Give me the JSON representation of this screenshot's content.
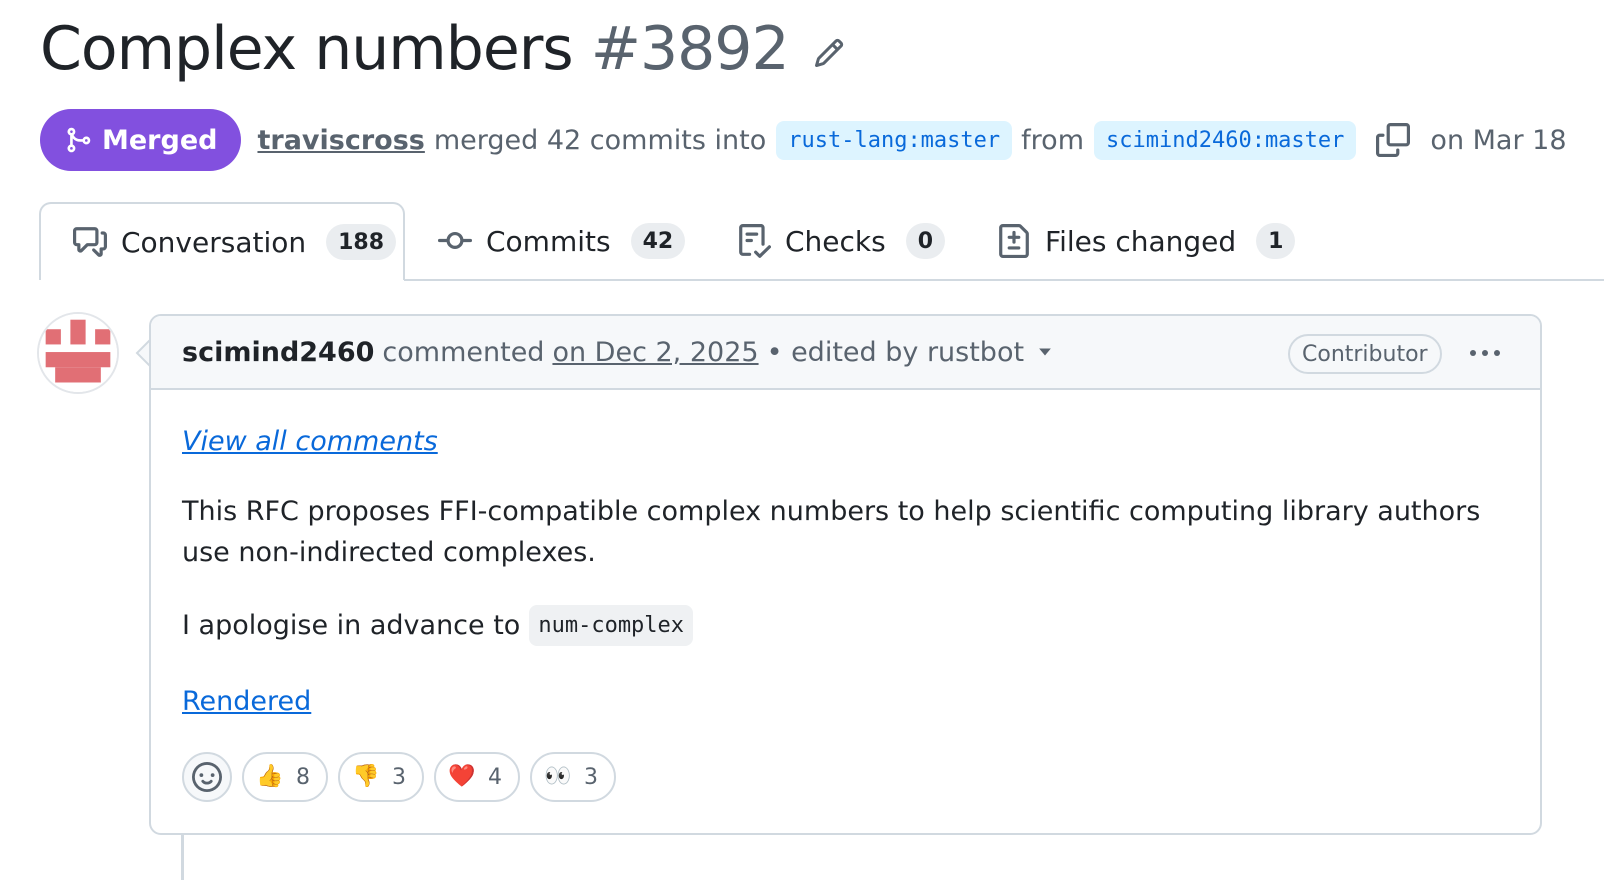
{
  "title": {
    "text": "Complex numbers",
    "number": "#3892"
  },
  "meta": {
    "state": "Merged",
    "author": "traviscross",
    "action": "merged 42 commits into",
    "base_branch": "rust-lang:master",
    "from_word": "from",
    "head_branch": "scimind2460:master",
    "date": "on Mar 18"
  },
  "tabs": [
    {
      "label": "Conversation",
      "count": "188",
      "icon": "comment-discussion-icon"
    },
    {
      "label": "Commits",
      "count": "42",
      "icon": "git-commit-icon"
    },
    {
      "label": "Checks",
      "count": "0",
      "icon": "checklist-icon"
    },
    {
      "label": "Files changed",
      "count": "1",
      "icon": "file-diff-icon"
    }
  ],
  "comment": {
    "author": "scimind2460",
    "verb": "commented",
    "date": "on Dec 2, 2025",
    "edited": "• edited by rustbot",
    "role": "Contributor",
    "view_all": "View all comments",
    "paragraph": "This RFC proposes FFI-compatible complex numbers to help scientific computing library authors use non-indirected complexes.",
    "apology_text": "I apologise in advance to",
    "apology_code": "num-complex",
    "rendered_link": "Rendered",
    "reactions": [
      {
        "emoji": "👍",
        "count": "8",
        "name": "thumbs-up"
      },
      {
        "emoji": "👎",
        "count": "3",
        "name": "thumbs-down"
      },
      {
        "emoji": "❤️",
        "count": "4",
        "name": "heart"
      },
      {
        "emoji": "👀",
        "count": "3",
        "name": "eyes"
      }
    ]
  },
  "colors": {
    "merged": "#8250df",
    "link": "#0969da",
    "branch_bg": "#ddf4ff",
    "avatar": "#e16f75"
  }
}
